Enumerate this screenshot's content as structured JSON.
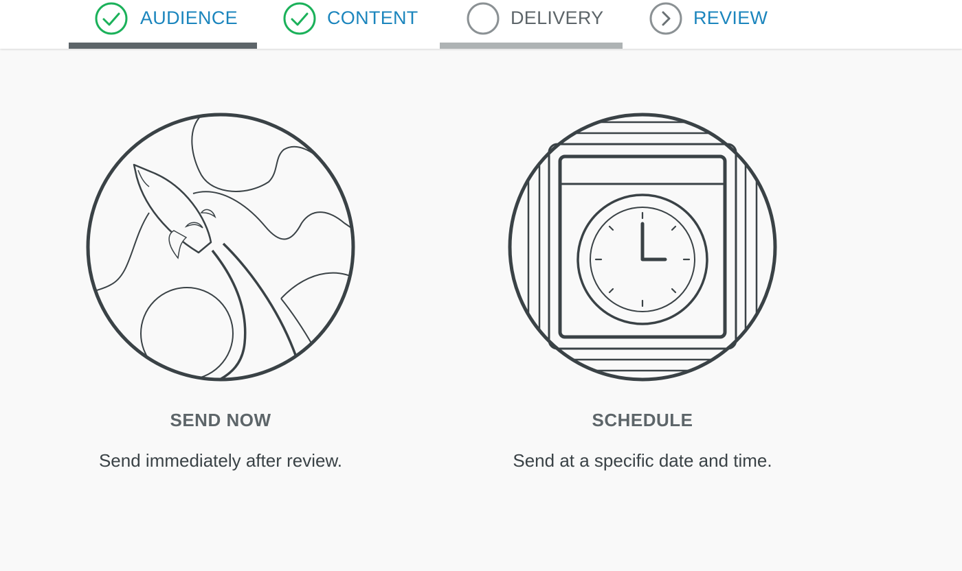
{
  "stepper": {
    "steps": [
      {
        "label": "AUDIENCE",
        "status": "complete",
        "icon": "check-circle-icon"
      },
      {
        "label": "CONTENT",
        "status": "complete",
        "icon": "check-circle-icon"
      },
      {
        "label": "DELIVERY",
        "status": "current",
        "icon": "empty-circle-icon"
      },
      {
        "label": "REVIEW",
        "status": "next",
        "icon": "chevron-right-circle-icon"
      }
    ]
  },
  "options": [
    {
      "title": "SEND NOW",
      "description": "Send immediately after review.",
      "icon": "rocket-icon"
    },
    {
      "title": "SCHEDULE",
      "description": "Send at a specific date and time.",
      "icon": "calendar-clock-icon"
    }
  ],
  "colors": {
    "accent_blue": "#1b85bd",
    "check_green": "#1bb15a",
    "dark_gray": "#5d6569",
    "light_gray": "#aeb3b4",
    "illustration_stroke": "#3a4246"
  }
}
